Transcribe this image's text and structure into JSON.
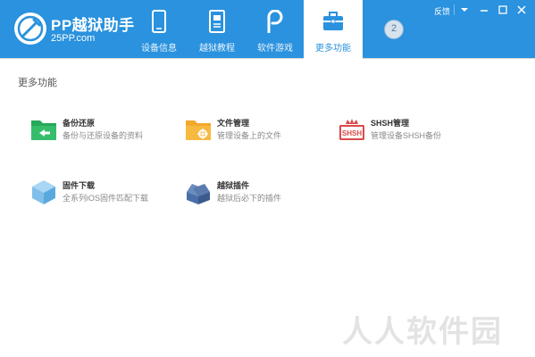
{
  "app": {
    "title": "PP越狱助手",
    "url": "25PP.com"
  },
  "nav": {
    "tabs": [
      {
        "label": "设备信息",
        "icon": "phone-icon"
      },
      {
        "label": "越狱教程",
        "icon": "book-icon"
      },
      {
        "label": "软件游戏",
        "icon": "pp-app-icon"
      },
      {
        "label": "更多功能",
        "icon": "toolbox-icon",
        "active": true
      }
    ]
  },
  "avatar": {
    "text": "2"
  },
  "window": {
    "feedback_label": "反馈"
  },
  "main": {
    "section_title": "更多功能",
    "features": [
      {
        "title": "备份还原",
        "desc": "备份与还原设备的资料",
        "icon": "backup-folder-icon"
      },
      {
        "title": "文件管理",
        "desc": "管理设备上的文件",
        "icon": "file-folder-icon"
      },
      {
        "title": "SHSH管理",
        "desc": "管理设备SHSH备份",
        "icon": "shsh-icon",
        "icon_text": "SHSH"
      },
      {
        "title": "固件下载",
        "desc": "全系列iOS固件匹配下载",
        "icon": "firmware-cube-icon"
      },
      {
        "title": "越狱插件",
        "desc": "越狱后必下的插件",
        "icon": "plugin-box-icon"
      }
    ]
  },
  "watermark": "人人软件园",
  "colors": {
    "header": "#2a92de",
    "active_tab_text": "#2a92de",
    "backup_icon": "#27a85a",
    "file_icon": "#f3a82c",
    "shsh_icon": "#d94a4a",
    "firmware_icon": "#7fbfea",
    "plugin_icon": "#4a6fa8"
  }
}
